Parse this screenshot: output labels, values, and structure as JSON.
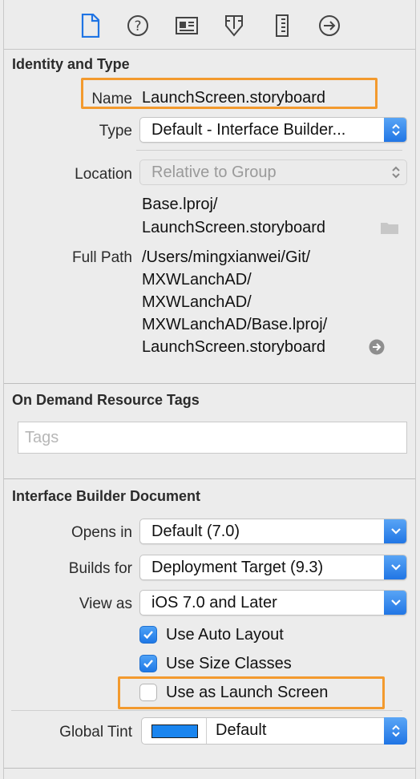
{
  "toolbar": {
    "icons": [
      "file-inspector-icon",
      "quick-help-icon",
      "identity-inspector-icon",
      "attributes-inspector-icon",
      "size-inspector-icon",
      "connections-inspector-icon"
    ]
  },
  "identity": {
    "title": "Identity and Type",
    "name_label": "Name",
    "name_value": "LaunchScreen.storyboard",
    "type_label": "Type",
    "type_value": "Default - Interface Builder...",
    "location_label": "Location",
    "location_value": "Relative to Group",
    "relative_path_line1": "Base.lproj/",
    "relative_path_line2": "LaunchScreen.storyboard",
    "full_path_label": "Full Path",
    "full_path_lines": [
      "/Users/mingxianwei/Git/",
      "MXWLanchAD/",
      "MXWLanchAD/",
      "MXWLanchAD/Base.lproj/",
      "LaunchScreen.storyboard"
    ]
  },
  "on_demand": {
    "title": "On Demand Resource Tags",
    "tags_placeholder": "Tags"
  },
  "ib_document": {
    "title": "Interface Builder Document",
    "opens_in_label": "Opens in",
    "opens_in_value": "Default (7.0)",
    "builds_for_label": "Builds for",
    "builds_for_value": "Deployment Target (9.3)",
    "view_as_label": "View as",
    "view_as_value": "iOS 7.0 and Later",
    "auto_layout_label": "Use Auto Layout",
    "auto_layout_checked": true,
    "size_classes_label": "Use Size Classes",
    "size_classes_checked": true,
    "launch_screen_label": "Use as Launch Screen",
    "launch_screen_checked": false,
    "global_tint_label": "Global Tint",
    "global_tint_value": "Default",
    "global_tint_color": "#1a85ef"
  },
  "colors": {
    "accent": "#1f74e4",
    "highlight": "#f39a2e"
  }
}
